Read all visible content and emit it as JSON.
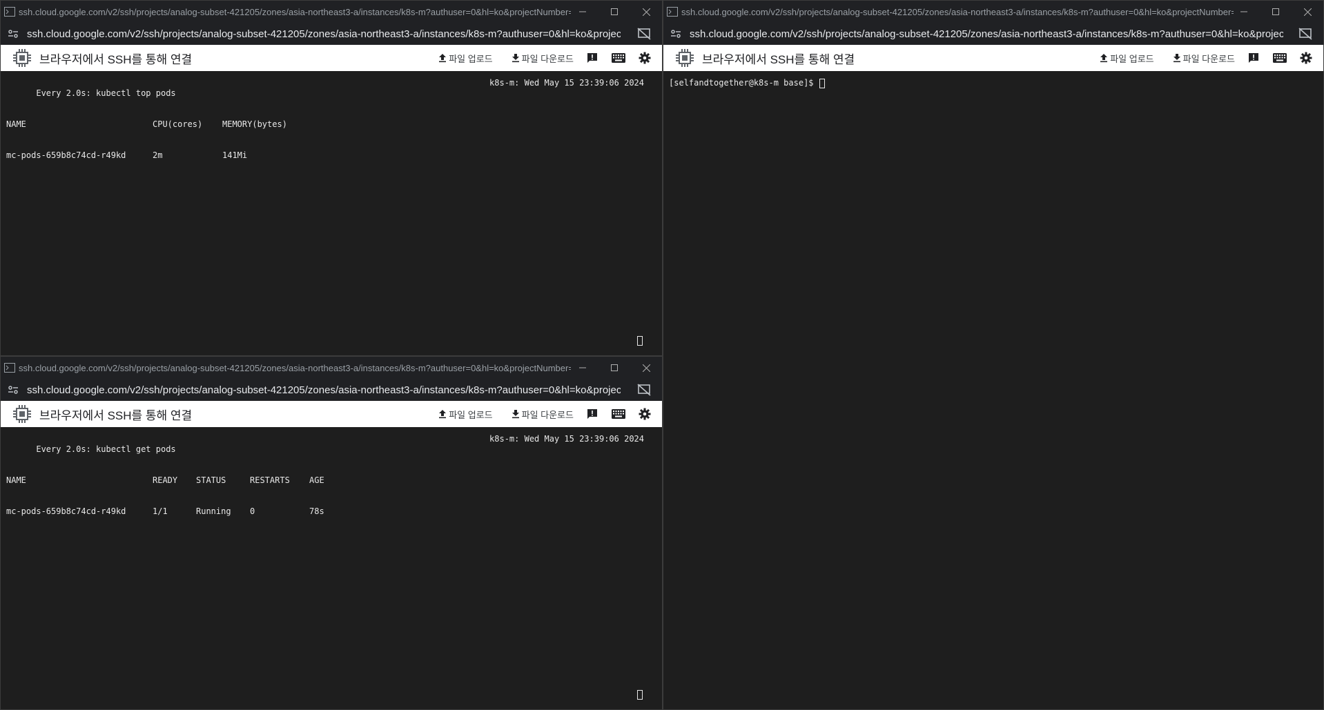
{
  "windows": {
    "top_left": {
      "title": "ssh.cloud.google.com/v2/ssh/projects/analog-subset-421205/zones/asia-northeast3-a/instances/k8s-m?authuser=0&hl=ko&projectNumber=12...",
      "url": "ssh.cloud.google.com/v2/ssh/projects/analog-subset-421205/zones/asia-northeast3-a/instances/k8s-m?authuser=0&hl=ko&projectNu...",
      "toolbar_title": "브라우저에서 SSH를 통해 연결",
      "upload_label": "파일 업로드",
      "download_label": "파일 다운로드",
      "terminal": {
        "header_left": "Every 2.0s: kubectl top pods",
        "header_right": "k8s-m: Wed May 15 23:39:06 2024",
        "columns": [
          "NAME",
          "CPU(cores)",
          "MEMORY(bytes)"
        ],
        "rows": [
          [
            "mc-pods-659b8c74cd-r49kd",
            "2m",
            "141Mi"
          ]
        ]
      }
    },
    "bottom_left": {
      "title": "ssh.cloud.google.com/v2/ssh/projects/analog-subset-421205/zones/asia-northeast3-a/instances/k8s-m?authuser=0&hl=ko&projectNumber=12...",
      "url": "ssh.cloud.google.com/v2/ssh/projects/analog-subset-421205/zones/asia-northeast3-a/instances/k8s-m?authuser=0&hl=ko&projectNu...",
      "toolbar_title": "브라우저에서 SSH를 통해 연결",
      "upload_label": "파일 업로드",
      "download_label": "파일 다운로드",
      "terminal": {
        "header_left": "Every 2.0s: kubectl get pods",
        "header_right": "k8s-m: Wed May 15 23:39:06 2024",
        "columns": [
          "NAME",
          "READY",
          "STATUS",
          "RESTARTS",
          "AGE"
        ],
        "rows": [
          [
            "mc-pods-659b8c74cd-r49kd",
            "1/1",
            "Running",
            "0",
            "78s"
          ]
        ]
      }
    },
    "right": {
      "title": "ssh.cloud.google.com/v2/ssh/projects/analog-subset-421205/zones/asia-northeast3-a/instances/k8s-m?authuser=0&hl=ko&projectNumber=12...",
      "url": "ssh.cloud.google.com/v2/ssh/projects/analog-subset-421205/zones/asia-northeast3-a/instances/k8s-m?authuser=0&hl=ko&projectNu...",
      "toolbar_title": "브라우저에서 SSH를 통해 연결",
      "upload_label": "파일 업로드",
      "download_label": "파일 다운로드",
      "terminal": {
        "prompt": "[selfandtogether@k8s-m base]$ "
      }
    }
  },
  "icons": {
    "minimize": "minimize-icon",
    "maximize": "maximize-icon",
    "close": "close-icon",
    "site_info": "tune-icon",
    "cast": "cast-off-icon",
    "chip": "chip-icon",
    "upload": "upload-icon",
    "download": "download-icon",
    "feedback": "feedback-icon",
    "keyboard": "keyboard-icon",
    "settings": "gear-icon"
  },
  "colors": {
    "terminal_bg": "#1e1e1e",
    "chrome_bg": "#202124",
    "toolbar_bg": "#ffffff",
    "terminal_text": "#e8e8e8"
  }
}
